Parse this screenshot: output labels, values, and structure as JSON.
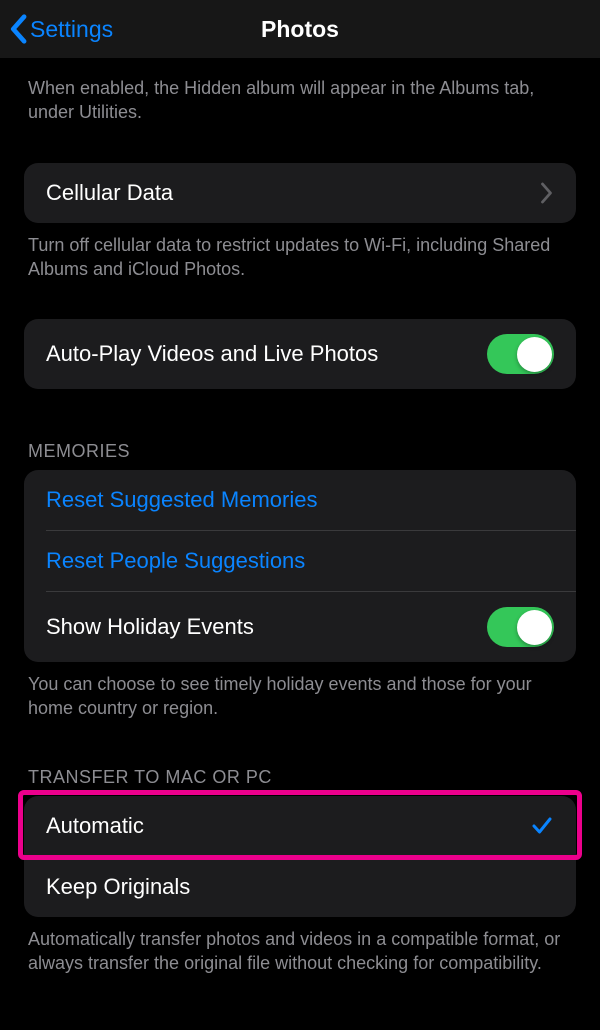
{
  "nav": {
    "back_label": "Settings",
    "title": "Photos"
  },
  "hidden_album": {
    "footer": "When enabled, the Hidden album will appear in the Albums tab, under Utilities."
  },
  "cellular": {
    "label": "Cellular Data",
    "footer": "Turn off cellular data to restrict updates to Wi-Fi, including Shared Albums and iCloud Photos."
  },
  "autoplay": {
    "label": "Auto-Play Videos and Live Photos",
    "on": true
  },
  "memories": {
    "header": "MEMORIES",
    "reset_suggested": "Reset Suggested Memories",
    "reset_people": "Reset People Suggestions",
    "holiday_label": "Show Holiday Events",
    "holiday_on": true,
    "footer": "You can choose to see timely holiday events and those for your home country or region."
  },
  "transfer": {
    "header": "TRANSFER TO MAC OR PC",
    "automatic": "Automatic",
    "keep_originals": "Keep Originals",
    "selected": "automatic",
    "footer": "Automatically transfer photos and videos in a compatible format, or always transfer the original file without checking for compatibility."
  }
}
